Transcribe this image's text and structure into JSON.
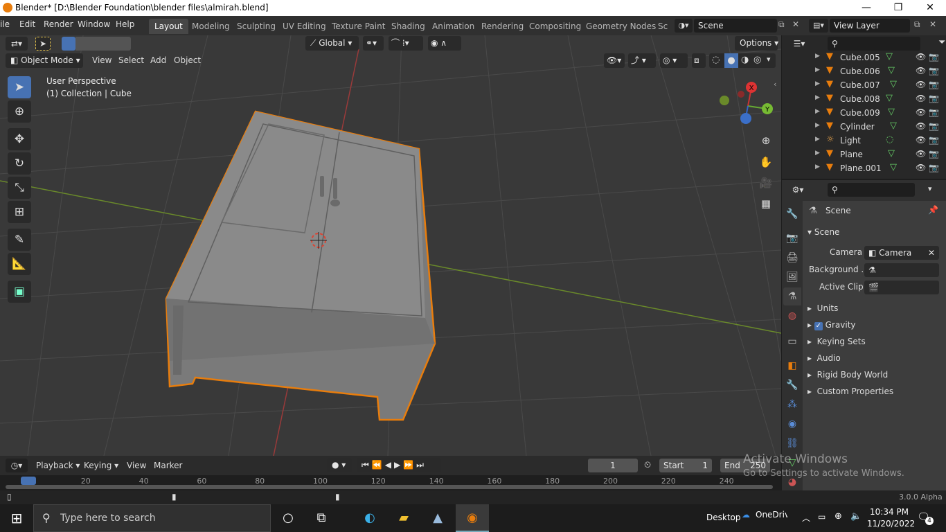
{
  "titlebar": {
    "title": "Blender* [D:\\Blender Foundation\\blender files\\almirah.blend]",
    "minimize": "—",
    "maximize": "❐",
    "close": "✕"
  },
  "menus": [
    "ile",
    "Edit",
    "Render",
    "Window",
    "Help"
  ],
  "workspaces": [
    "Layout",
    "Modeling",
    "Sculpting",
    "UV Editing",
    "Texture Paint",
    "Shading",
    "Animation",
    "Rendering",
    "Compositing",
    "Geometry Nodes",
    "Sc"
  ],
  "scene": {
    "name": "Scene",
    "view_layer": "View Layer"
  },
  "header": {
    "transform": "Global",
    "options": "Options",
    "mode": "Object Mode",
    "view": "View",
    "select": "Select",
    "add": "Add",
    "object": "Object"
  },
  "viewport": {
    "perspective": "User Perspective",
    "collection": "(1) Collection | Cube",
    "axes": {
      "x": "X",
      "y": "Y"
    }
  },
  "outliner": {
    "items": [
      {
        "label": "Cube.005",
        "icon": "mesh-icon"
      },
      {
        "label": "Cube.006",
        "icon": "mesh-icon"
      },
      {
        "label": "Cube.007",
        "icon": "mesh-icon"
      },
      {
        "label": "Cube.008",
        "icon": "mesh-icon"
      },
      {
        "label": "Cube.009",
        "icon": "mesh-icon"
      },
      {
        "label": "Cylinder",
        "icon": "mesh-icon"
      },
      {
        "label": "Light",
        "icon": "light-icon"
      },
      {
        "label": "Plane",
        "icon": "mesh-icon"
      },
      {
        "label": "Plane.001",
        "icon": "mesh-icon"
      }
    ]
  },
  "properties": {
    "header": "Scene",
    "section": "Scene",
    "camera_label": "Camera",
    "camera_value": "Camera",
    "background_label": "Background ...",
    "active_clip_label": "Active Clip",
    "sections": [
      "Units",
      "Gravity",
      "Keying Sets",
      "Audio",
      "Rigid Body World",
      "Custom Properties"
    ],
    "gravity_checked": true
  },
  "timeline": {
    "playback": "Playback",
    "keying": "Keying",
    "view": "View",
    "marker": "Marker",
    "frame": "1",
    "start_label": "Start",
    "start": "1",
    "end_label": "End",
    "end": "250",
    "ruler": [
      "1",
      "20",
      "40",
      "60",
      "80",
      "100",
      "120",
      "140",
      "160",
      "180",
      "200",
      "220",
      "240"
    ]
  },
  "watermark": {
    "line1": "Activate Windows",
    "line2": "Go to Settings to activate Windows."
  },
  "status": {
    "version": "3.0.0 Alpha"
  },
  "taskbar": {
    "search": "Type here to search",
    "desktop": "Desktop",
    "onedrive": "OneDrive",
    "time": "10:34 PM",
    "date": "11/20/2022",
    "notif": "4"
  },
  "colors": {
    "accent": "#4772b3",
    "selection": "#e87d0d",
    "x_axis": "#9a3a3a",
    "y_axis": "#6a8a2a"
  }
}
